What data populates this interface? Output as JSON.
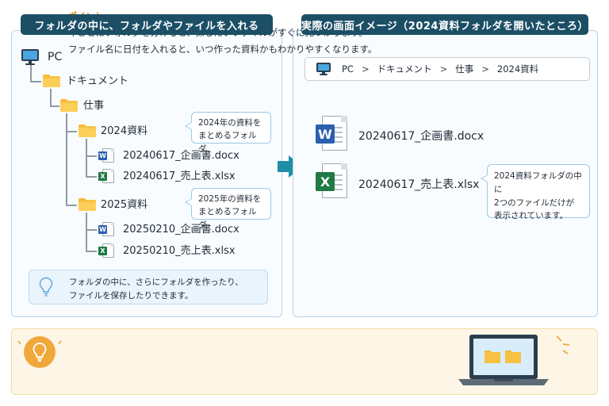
{
  "left_panel": {
    "header": "フォルダの中に、フォルダやファイルを入れる",
    "tree": {
      "pc": "PC",
      "documents": "ドキュメント",
      "work": "仕事",
      "folder_2024": "2024資料",
      "folder_2024_files": [
        "20240617_企画書.docx",
        "20240617_売上表.xlsx"
      ],
      "folder_2025": "2025資料",
      "folder_2025_files": [
        "20250210_企画書.docx",
        "20250210_売上表.xlsx"
      ]
    },
    "bubble_2024": [
      "2024年の資料を",
      "まとめるフォルダ"
    ],
    "bubble_2025": [
      "2025年の資料を",
      "まとめるフォルダ"
    ],
    "tip": [
      "フォルダの中に、さらにフォルダを作ったり、",
      "ファイルを保存したりできます。"
    ]
  },
  "right_panel": {
    "header": "実際の画面イメージ（2024資料フォルダを開いたところ）",
    "breadcrumb": [
      "PC",
      "ドキュメント",
      "仕事",
      "2024資料"
    ],
    "breadcrumb_separator": ">",
    "files": [
      "20240617_企画書.docx",
      "20240617_売上表.xlsx"
    ],
    "bubble": [
      "2024資料フォルダの中に",
      "2つのファイルだけが",
      "表示されています。"
    ]
  },
  "point": {
    "title": "ポイント",
    "lines": [
      "年ごとにフォルダを分けると、探したいファイルがすぐに見つかります。",
      "ファイル名に日付を入れると、いつ作った資料かもわかりやすくなります。"
    ]
  },
  "icons": {
    "word_badge": "W",
    "excel_badge": "X"
  },
  "colors": {
    "header_bg": "#1c4f66",
    "accent_teal": "#1f8fa6",
    "folder": "#f7c243",
    "word": "#2b5fb0",
    "excel": "#1f7a44",
    "point_title": "#e58f16"
  }
}
